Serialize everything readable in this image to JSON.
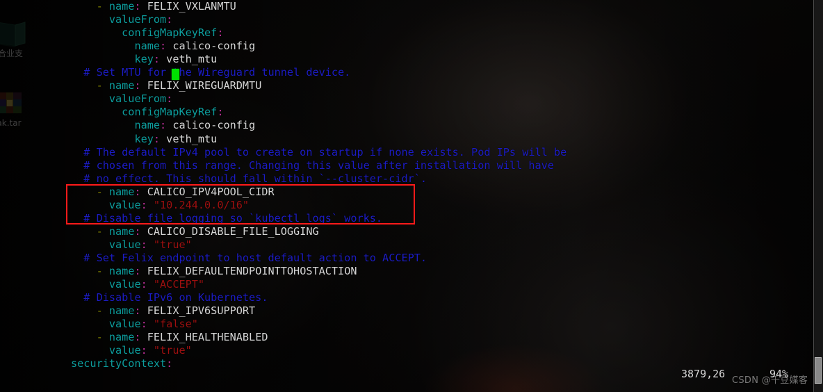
{
  "window": {
    "type": "terminal-vim-editor",
    "background_color": "#000000"
  },
  "desktop": {
    "icons": [
      {
        "name": "document-icon",
        "glyph": "book-icon",
        "label": "合业支"
      },
      {
        "name": "archive-icon",
        "glyph": "archive-icon",
        "label": "ak.tar"
      }
    ]
  },
  "editor": {
    "filetype": "yaml",
    "indent_unit": "  ",
    "colors": {
      "dash": "#808000",
      "key": "#0d9d9d",
      "colon": "#c0319b",
      "plain": "#d6d6d6",
      "string": "#9e1010",
      "comment": "#1c1cc4",
      "cursor": "#00e000",
      "highlight_box": "#ff1a1a"
    },
    "cursor": {
      "name": "block-cursor",
      "line_index": 5,
      "column_char": 15
    },
    "lines": [
      {
        "indent": "    ",
        "tokens": [
          {
            "t": "dash",
            "v": "- "
          },
          {
            "t": "key",
            "v": "name"
          },
          {
            "t": "colon",
            "v": ": "
          },
          {
            "t": "plain",
            "v": "FELIX_VXLANMTU"
          }
        ]
      },
      {
        "indent": "      ",
        "tokens": [
          {
            "t": "key",
            "v": "valueFrom"
          },
          {
            "t": "colon",
            "v": ":"
          }
        ]
      },
      {
        "indent": "        ",
        "tokens": [
          {
            "t": "key",
            "v": "configMapKeyRef"
          },
          {
            "t": "colon",
            "v": ":"
          }
        ]
      },
      {
        "indent": "          ",
        "tokens": [
          {
            "t": "key",
            "v": "name"
          },
          {
            "t": "colon",
            "v": ": "
          },
          {
            "t": "plain",
            "v": "calico-config"
          }
        ]
      },
      {
        "indent": "          ",
        "tokens": [
          {
            "t": "key",
            "v": "key"
          },
          {
            "t": "colon",
            "v": ": "
          },
          {
            "t": "plain",
            "v": "veth_mtu"
          }
        ]
      },
      {
        "indent": "  ",
        "tokens": [
          {
            "t": "comment",
            "v": "# Set MTU for the Wireguard tunnel device."
          }
        ]
      },
      {
        "indent": "    ",
        "tokens": [
          {
            "t": "dash",
            "v": "- "
          },
          {
            "t": "key",
            "v": "name"
          },
          {
            "t": "colon",
            "v": ": "
          },
          {
            "t": "plain",
            "v": "FELIX_WIREGUARDMTU"
          }
        ]
      },
      {
        "indent": "      ",
        "tokens": [
          {
            "t": "key",
            "v": "valueFrom"
          },
          {
            "t": "colon",
            "v": ":"
          }
        ]
      },
      {
        "indent": "        ",
        "tokens": [
          {
            "t": "key",
            "v": "configMapKeyRef"
          },
          {
            "t": "colon",
            "v": ":"
          }
        ]
      },
      {
        "indent": "          ",
        "tokens": [
          {
            "t": "key",
            "v": "name"
          },
          {
            "t": "colon",
            "v": ": "
          },
          {
            "t": "plain",
            "v": "calico-config"
          }
        ]
      },
      {
        "indent": "          ",
        "tokens": [
          {
            "t": "key",
            "v": "key"
          },
          {
            "t": "colon",
            "v": ": "
          },
          {
            "t": "plain",
            "v": "veth_mtu"
          }
        ]
      },
      {
        "indent": "  ",
        "tokens": [
          {
            "t": "comment",
            "v": "# The default IPv4 pool to create on startup if none exists. Pod IPs will be"
          }
        ]
      },
      {
        "indent": "  ",
        "tokens": [
          {
            "t": "comment",
            "v": "# chosen from this range. Changing this value after installation will have"
          }
        ]
      },
      {
        "indent": "  ",
        "tokens": [
          {
            "t": "comment",
            "v": "# no effect. This should fall within `--cluster-cidr`."
          }
        ]
      },
      {
        "indent": "    ",
        "tokens": [
          {
            "t": "dash",
            "v": "- "
          },
          {
            "t": "key",
            "v": "name"
          },
          {
            "t": "colon",
            "v": ": "
          },
          {
            "t": "plain",
            "v": "CALICO_IPV4POOL_CIDR"
          }
        ]
      },
      {
        "indent": "      ",
        "tokens": [
          {
            "t": "key",
            "v": "value"
          },
          {
            "t": "colon",
            "v": ": "
          },
          {
            "t": "string",
            "v": "\"10.244.0.0/16\""
          }
        ]
      },
      {
        "indent": "  ",
        "tokens": [
          {
            "t": "comment",
            "v": "# Disable file logging so `kubectl logs` works."
          }
        ]
      },
      {
        "indent": "    ",
        "tokens": [
          {
            "t": "dash",
            "v": "- "
          },
          {
            "t": "key",
            "v": "name"
          },
          {
            "t": "colon",
            "v": ": "
          },
          {
            "t": "plain",
            "v": "CALICO_DISABLE_FILE_LOGGING"
          }
        ]
      },
      {
        "indent": "      ",
        "tokens": [
          {
            "t": "key",
            "v": "value"
          },
          {
            "t": "colon",
            "v": ": "
          },
          {
            "t": "string",
            "v": "\"true\""
          }
        ]
      },
      {
        "indent": "  ",
        "tokens": [
          {
            "t": "comment",
            "v": "# Set Felix endpoint to host default action to ACCEPT."
          }
        ]
      },
      {
        "indent": "    ",
        "tokens": [
          {
            "t": "dash",
            "v": "- "
          },
          {
            "t": "key",
            "v": "name"
          },
          {
            "t": "colon",
            "v": ": "
          },
          {
            "t": "plain",
            "v": "FELIX_DEFAULTENDPOINTTOHOSTACTION"
          }
        ]
      },
      {
        "indent": "      ",
        "tokens": [
          {
            "t": "key",
            "v": "value"
          },
          {
            "t": "colon",
            "v": ": "
          },
          {
            "t": "string",
            "v": "\"ACCEPT\""
          }
        ]
      },
      {
        "indent": "  ",
        "tokens": [
          {
            "t": "comment",
            "v": "# Disable IPv6 on Kubernetes."
          }
        ]
      },
      {
        "indent": "    ",
        "tokens": [
          {
            "t": "dash",
            "v": "- "
          },
          {
            "t": "key",
            "v": "name"
          },
          {
            "t": "colon",
            "v": ": "
          },
          {
            "t": "plain",
            "v": "FELIX_IPV6SUPPORT"
          }
        ]
      },
      {
        "indent": "      ",
        "tokens": [
          {
            "t": "key",
            "v": "value"
          },
          {
            "t": "colon",
            "v": ": "
          },
          {
            "t": "string",
            "v": "\"false\""
          }
        ]
      },
      {
        "indent": "    ",
        "tokens": [
          {
            "t": "dash",
            "v": "- "
          },
          {
            "t": "key",
            "v": "name"
          },
          {
            "t": "colon",
            "v": ": "
          },
          {
            "t": "plain",
            "v": "FELIX_HEALTHENABLED"
          }
        ]
      },
      {
        "indent": "      ",
        "tokens": [
          {
            "t": "key",
            "v": "value"
          },
          {
            "t": "colon",
            "v": ": "
          },
          {
            "t": "string",
            "v": "\"true\""
          }
        ]
      },
      {
        "indent": "",
        "tokens": [
          {
            "t": "key",
            "v": "securityContext"
          },
          {
            "t": "colon",
            "v": ":"
          }
        ]
      }
    ]
  },
  "annotation": {
    "name": "red-highlight-box",
    "covers_lines": [
      14,
      15,
      16
    ],
    "color": "#ff1a1a"
  },
  "status_bar": {
    "position": "3879,26",
    "percent": "94%"
  },
  "watermark": {
    "text": "CSDN @千豆媒客"
  },
  "scrollbar": {
    "name": "vertical-scrollbar",
    "thumb_position_percent": 94
  }
}
